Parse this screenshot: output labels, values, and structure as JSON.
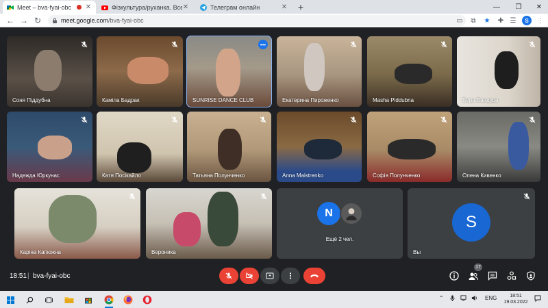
{
  "browser": {
    "tabs": [
      {
        "title": "Meet – bva-fyai-obc",
        "active": true
      },
      {
        "title": "Фізкультура/руханка. Всеукраїнс",
        "active": false
      },
      {
        "title": "Телеграм онлайн",
        "active": false
      }
    ],
    "url_host": "meet.google.com",
    "url_path": "/bva-fyai-obc",
    "profile_initial": "S"
  },
  "meet": {
    "participants": [
      {
        "name": "Соня Піддубна"
      },
      {
        "name": "Каміла Бадрак"
      },
      {
        "name": "SUNRISE DANCE CLUB"
      },
      {
        "name": "Екатерина Пироженко"
      },
      {
        "name": "Masha Piddubna"
      },
      {
        "name": "Вера Бандура"
      },
      {
        "name": "Надежда Юркунас"
      },
      {
        "name": "Катя Посікайло"
      },
      {
        "name": "Татьяна Полунченко"
      },
      {
        "name": "Anna Maistrenko"
      },
      {
        "name": "Софія Полунченко"
      },
      {
        "name": "Олена Кивенко"
      },
      {
        "name": "Каріна Капюжна"
      },
      {
        "name": "Вероника"
      }
    ],
    "others_tile": {
      "label": "Ещё 2 чел.",
      "avatar_initial": "N",
      "avatar_color": "#1a73e8"
    },
    "self_tile": {
      "name": "Вы",
      "avatar_initial": "S",
      "avatar_color": "#1967d2"
    },
    "controls": {
      "time": "18:51",
      "separator": "|",
      "meeting_code": "bva-fyai-obc",
      "participant_count": "17"
    }
  },
  "taskbar": {
    "language": "ENG",
    "time": "18:51",
    "date": "19.03.2022"
  },
  "colors": {
    "meet_bg": "#202124",
    "tile_bg": "#3c4043",
    "danger_red": "#ea4335",
    "accent_blue": "#1a73e8"
  }
}
